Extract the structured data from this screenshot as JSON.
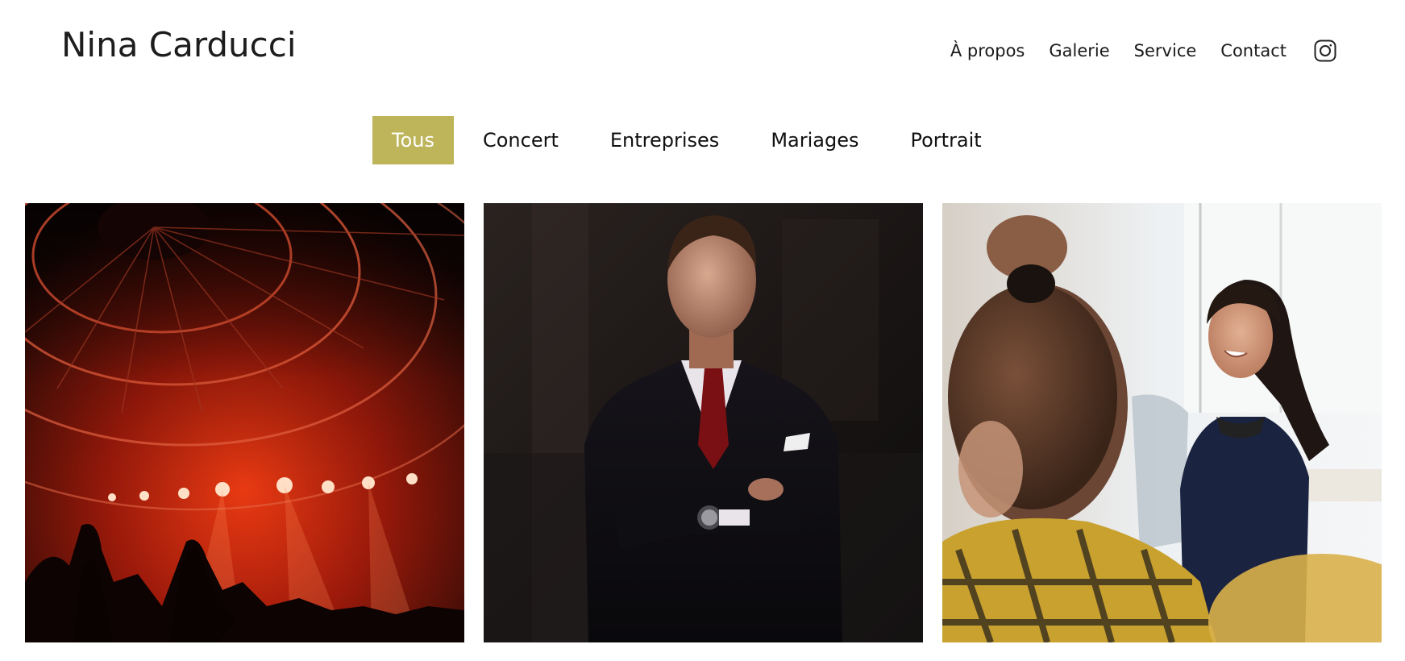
{
  "header": {
    "brand": "Nina Carducci",
    "nav": {
      "about": "À propos",
      "gallery": "Galerie",
      "service": "Service",
      "contact": "Contact",
      "instagram_icon": "instagram-icon"
    }
  },
  "filters": [
    {
      "label": "Tous"
    },
    {
      "label": "Concert"
    },
    {
      "label": "Entreprises"
    },
    {
      "label": "Mariages"
    },
    {
      "label": "Portrait"
    }
  ],
  "gallery": [
    {
      "alt": "Concert"
    },
    {
      "alt": "Portrait homme en costume"
    },
    {
      "alt": "Femme souriante au bureau"
    }
  ],
  "colors": {
    "accent": "#beb45a",
    "text": "#1a1a1a",
    "background": "#ffffff"
  }
}
